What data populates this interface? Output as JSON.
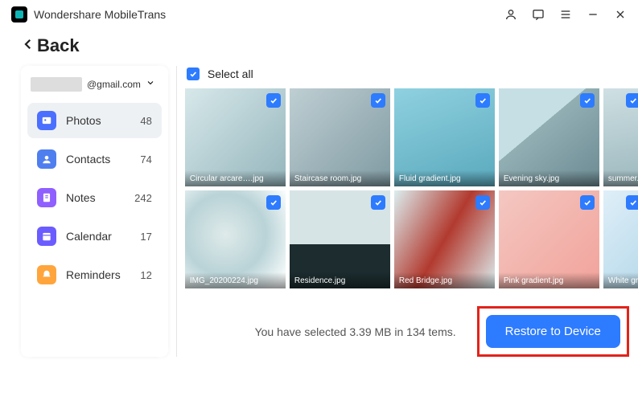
{
  "app": {
    "title": "Wondershare MobileTrans"
  },
  "back": {
    "label": "Back"
  },
  "account": {
    "email_suffix": "@gmail.com"
  },
  "categories": [
    {
      "label": "Photos",
      "count": "48",
      "icon": "photos",
      "active": true
    },
    {
      "label": "Contacts",
      "count": "74",
      "icon": "contacts",
      "active": false
    },
    {
      "label": "Notes",
      "count": "242",
      "icon": "notes",
      "active": false
    },
    {
      "label": "Calendar",
      "count": "17",
      "icon": "calendar",
      "active": false
    },
    {
      "label": "Reminders",
      "count": "12",
      "icon": "reminders",
      "active": false
    }
  ],
  "select_all": {
    "label": "Select all"
  },
  "photos": {
    "row1": [
      {
        "label": "Circular arcare….jpg",
        "bg": "bg1"
      },
      {
        "label": "Staircase room.jpg",
        "bg": "bg2"
      },
      {
        "label": "Fluid gradient.jpg",
        "bg": "bg3"
      },
      {
        "label": "Evening sky.jpg",
        "bg": "bg4"
      },
      {
        "label": "summer.jpg",
        "bg": "bg5",
        "partial": true
      }
    ],
    "row2": [
      {
        "label": "IMG_20200224.jpg",
        "bg": "bg6"
      },
      {
        "label": "Residence.jpg",
        "bg": "bg7"
      },
      {
        "label": "Red Bridge.jpg",
        "bg": "bg8"
      },
      {
        "label": "Pink gradient.jpg",
        "bg": "bg9"
      },
      {
        "label": "White grad",
        "bg": "bg10",
        "partial": true
      }
    ]
  },
  "footer": {
    "status": "You have selected 3.39 MB in 134 tems.",
    "restore": "Restore to Device"
  }
}
